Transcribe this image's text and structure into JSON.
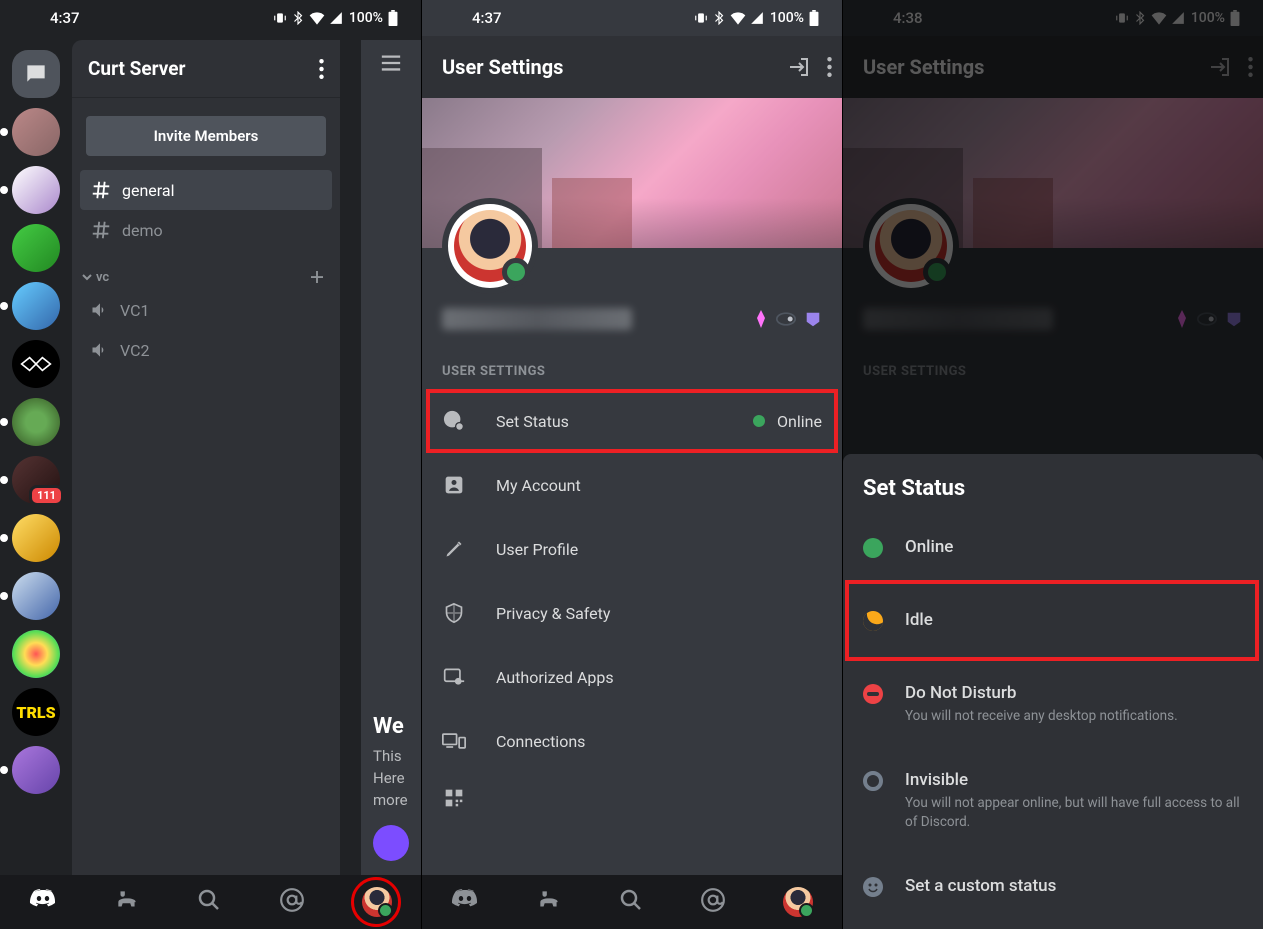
{
  "status_bar": {
    "s1_time": "4:37",
    "s2_time": "4:37",
    "s3_time": "4:38",
    "battery": "100%"
  },
  "screen1": {
    "server_name": "Curt Server",
    "invite_label": "Invite Members",
    "channels": {
      "general": "general",
      "demo": "demo"
    },
    "category_vc": "vc",
    "voice": {
      "vc1": "VC1",
      "vc2": "VC2"
    },
    "bg_welcome": "We",
    "bg_line1": "This",
    "bg_line2": "Here",
    "bg_line3": "more",
    "badge_111": "111"
  },
  "screen2": {
    "title": "User Settings",
    "section": "USER SETTINGS",
    "rows": {
      "set_status": "Set Status",
      "status_value": "Online",
      "my_account": "My Account",
      "user_profile": "User Profile",
      "privacy": "Privacy & Safety",
      "authorized": "Authorized Apps",
      "connections": "Connections"
    }
  },
  "screen3": {
    "title": "User Settings",
    "section": "USER SETTINGS",
    "sheet_title": "Set Status",
    "online": "Online",
    "idle": "Idle",
    "dnd": "Do Not Disturb",
    "dnd_desc": "You will not receive any desktop notifications.",
    "invisible": "Invisible",
    "invisible_desc": "You will not appear online, but will have full access to all of Discord.",
    "custom": "Set a custom status"
  }
}
